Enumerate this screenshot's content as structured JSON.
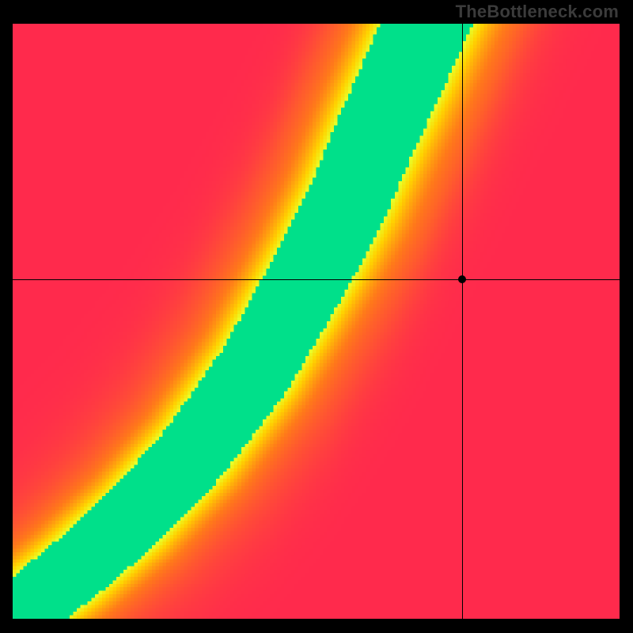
{
  "watermark": "TheBottleneck.com",
  "chart_data": {
    "type": "heatmap",
    "title": "",
    "xlabel": "",
    "ylabel": "",
    "xlim": [
      0,
      1
    ],
    "ylim": [
      0,
      1
    ],
    "crosshair": {
      "x": 0.74,
      "y": 0.57
    },
    "marker": {
      "x": 0.74,
      "y": 0.57
    },
    "optimal_curve_description": "Narrow green ridge running from bottom-left corner upward with increasing slope, reaching top edge around x≈0.68; field transitions yellow→orange→red away from ridge.",
    "optimal_curve_points": [
      {
        "x": 0.0,
        "y": 0.0
      },
      {
        "x": 0.1,
        "y": 0.08
      },
      {
        "x": 0.2,
        "y": 0.17
      },
      {
        "x": 0.3,
        "y": 0.28
      },
      {
        "x": 0.4,
        "y": 0.42
      },
      {
        "x": 0.5,
        "y": 0.6
      },
      {
        "x": 0.55,
        "y": 0.7
      },
      {
        "x": 0.6,
        "y": 0.82
      },
      {
        "x": 0.65,
        "y": 0.93
      },
      {
        "x": 0.68,
        "y": 1.0
      }
    ],
    "color_stops": [
      {
        "t": 0.0,
        "color": "#ff2a4d"
      },
      {
        "t": 0.4,
        "color": "#ff7a1a"
      },
      {
        "t": 0.7,
        "color": "#ffd400"
      },
      {
        "t": 0.88,
        "color": "#e8ff2a"
      },
      {
        "t": 1.0,
        "color": "#00e08a"
      }
    ],
    "ridge_half_width": 0.055,
    "pixelation": 170
  }
}
